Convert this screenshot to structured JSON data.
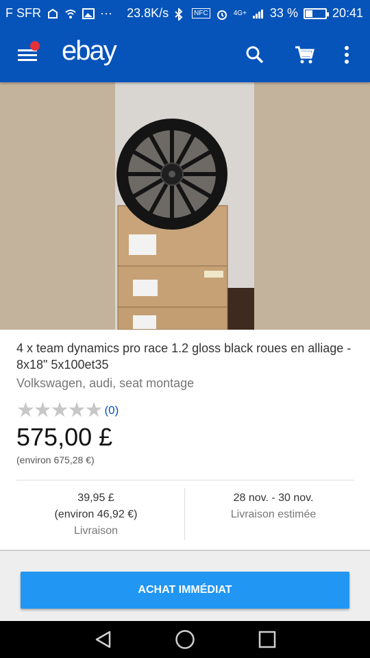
{
  "status_bar": {
    "carrier": "F SFR",
    "ellipsis": "···",
    "speed": "23.8K/s",
    "nfc": "NFC",
    "network": "4G+",
    "battery_percent": "33 %",
    "battery_level": 0.33,
    "time": "20:41"
  },
  "header": {
    "logo": "ebay",
    "icons": [
      "menu-icon",
      "search-icon",
      "cart-icon",
      "more-vertical-icon"
    ],
    "brand_color": "#0654ba",
    "notification_color": "#e53238"
  },
  "listing": {
    "title": "4 x team dynamics pro race 1.2 gloss black roues en alliage - 8x18\" 5x100et35",
    "subtitle": "Volkswagen, audi, seat montage",
    "stars": "★★★★★",
    "rating_value": 0,
    "rating_count": "(0)",
    "price": "575,00 £",
    "price_approx": "(environ 675,28 €)"
  },
  "shipping": {
    "cost": "39,95 £",
    "cost_approx": "(environ 46,92 €)",
    "cost_label": "Livraison",
    "dates": "28 nov. - 30 nov.",
    "dates_label": "Livraison estimée"
  },
  "actions": {
    "buy_now": "ACHAT IMMÉDIAT",
    "button_color": "#2196f3"
  },
  "nav": {
    "icons": [
      "back-icon",
      "home-icon",
      "recents-icon"
    ]
  }
}
